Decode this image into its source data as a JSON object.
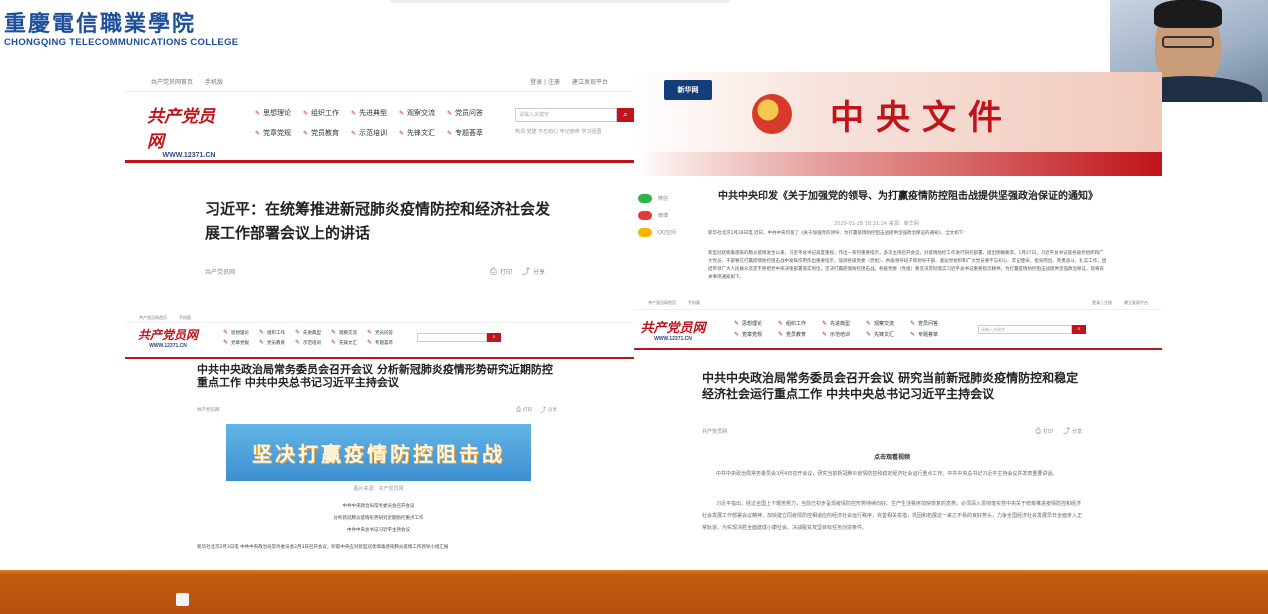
{
  "college": {
    "name_cn": "重慶電信職業學院",
    "name_en": "CHONGQING TELECOMMUNICATIONS COLLEGE"
  },
  "site": {
    "logo_cn": "共产党员网",
    "logo_url": "WWW.12371.CN",
    "topnav_left": [
      "共产党员网首页",
      "手机版"
    ],
    "topnav_right": [
      "登录 | 注册",
      "建立发现平台"
    ],
    "nav_items": [
      "思想理论",
      "组织工作",
      "先进典型",
      "观察交流",
      "党员问答",
      "党章党规",
      "党员教育",
      "示范培训",
      "先锋文汇",
      "专题荟萃"
    ],
    "search_placeholder": "请输入关键字",
    "hot_words": "热词  党建  不忘初心 牢记使命  学习强国"
  },
  "panel_a": {
    "title": "习近平：在统筹推进新冠肺炎疫情防控和经济社会发展工作部署会议上的讲话",
    "source": "共产党员网",
    "print": "打印",
    "share": "分享"
  },
  "panel_b": {
    "title": "中共中央政治局常务委员会召开会议 分析新冠肺炎疫情形势研究近期防控重点工作 中共中央总书记习近平主持会议",
    "source": "共产党员网",
    "print": "打印",
    "share": "分享",
    "banner_text": "坚决打赢疫情防控阻击战",
    "banner_caption": "图片来源：共产党员网",
    "summary_lines": [
      "中共中央政治局常务委员会召开会议",
      "分析新冠肺炎疫情形势研究近期防控重点工作",
      "中共中央总书记习近平主持会议"
    ],
    "lead": "新华社北京2月3日电 中共中央政治局常务委员会2月3日召开会议，听取中央应对新型冠状病毒感染肺炎疫情工作领导小组汇报"
  },
  "panel_c": {
    "xinhua": "新华网",
    "header_text": "中央文件",
    "share_items": [
      "微信",
      "微博",
      "QQ空间"
    ],
    "title": "中共中央印发《关于加强党的领导、为打赢疫情防控阻击战提供坚强政治保证的通知》",
    "meta": "2020-01-28 18:31:24  来源：新华网",
    "para1": "新华社北京1月28日电 近日，中共中央印发了《关于加强党的领导、为打赢疫情防控阻击战提供坚强政治保证的通知》，全文如下：",
    "para2": "新型冠状病毒感染的肺炎疫情发生以来，习近平总书记高度重视，作出一系列重要指示，多次主持召开会议，对疫情防控工作进行研究部署，提出明确要求。1月27日，习近平总书记就各级党组织和广大党员、干部要在打赢疫情防控阻击战中发挥作用作出重要指示，强调各级党委（党组）、各级领导班子和领导干部、基层党组织和广大党员要不忘初心、牢记使命，挺身而出、英勇奋斗、扎实工作，团结带领广大人民群众坚定不移把党中央决策部署落实到位，坚决打赢疫情防控阻击战。各级党委（党组）要坚决贯彻落实习近平总书记重要指示精神，为打赢疫情防控阻击战提供坚强政治保证，现将有关事项通知如下。"
  },
  "panel_d": {
    "title": "中共中央政治局常务委员会召开会议 研究当前新冠肺炎疫情防控和稳定经济社会运行重点工作 中共中央总书记习近平主持会议",
    "source": "共产党员网",
    "print": "打印",
    "share": "分享",
    "video_label": "点击观看视频",
    "para1": "中共中央政治局常务委员会3月4日召开会议，研究当前新冠肺炎疫情防控和稳定经济社会运行重点工作。中共中央总书记习近平主持会议并发表重要讲话。",
    "para2": "习近平指出，经过全国上下艰苦努力，当前已初步呈现疫情防控形势持续向好、生产生活秩序加快恢复的态势。必须深入贯彻落实党中央关于统筹推进疫情防控和经济社会发展工作部署会议精神，加快建立同疫情防控相适应的经济社会运行秩序，完善相关举措，巩固和拓展这一来之不易的良好势头，力争全国经济社会发展早日全面步入正常轨道，为实现决胜全面建成小康社会、决战脱贫攻坚目标任务创造条件。"
  }
}
